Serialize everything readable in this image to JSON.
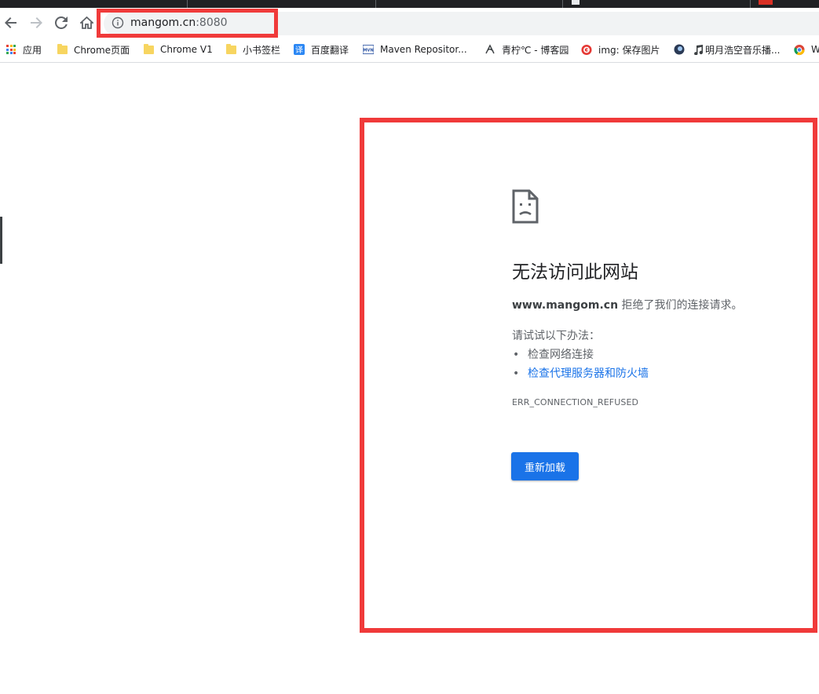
{
  "browser": {
    "address_bar": {
      "host": "mangom.cn",
      "port": ":8080"
    },
    "bookmarks": [
      {
        "label": "应用",
        "icon": "apps-grid-icon"
      },
      {
        "label": "Chrome页面",
        "icon": "folder-icon"
      },
      {
        "label": "Chrome V1",
        "icon": "folder-icon"
      },
      {
        "label": "小书签栏",
        "icon": "folder-icon"
      },
      {
        "label": "百度翻译",
        "icon": "translate-icon"
      },
      {
        "label": "Maven Repositor...",
        "icon": "maven-icon"
      },
      {
        "label": "青柠℃ - 博客园",
        "icon": "blog-icon"
      },
      {
        "label": "img: 保存图片",
        "icon": "img-save-icon"
      },
      {
        "label": "",
        "icon": "site-icon"
      },
      {
        "label": "明月浩空音乐播...",
        "icon": "music-note-icon"
      },
      {
        "label": "W",
        "icon": "chrome-icon"
      }
    ]
  },
  "error_page": {
    "title": "无法访问此网站",
    "host_bold": "www.mangom.cn",
    "refused_text": " 拒绝了我们的连接请求。",
    "try_heading": "请试试以下办法：",
    "suggestions": [
      "检查网络连接",
      "检查代理服务器和防火墙"
    ],
    "error_code": "ERR_CONNECTION_REFUSED",
    "reload_label": "重新加载"
  },
  "colors": {
    "highlight": "#f03a3a",
    "link": "#1a73e8",
    "button": "#1a73e8"
  }
}
